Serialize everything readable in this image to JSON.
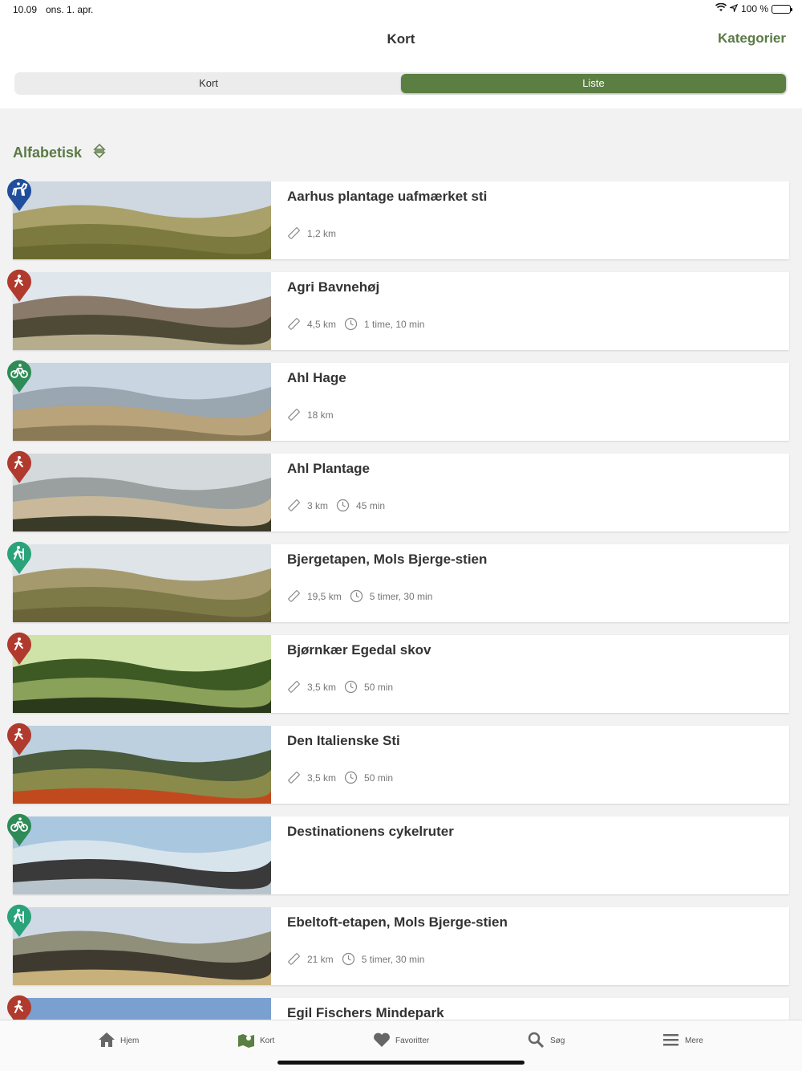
{
  "status": {
    "time": "10.09",
    "date": "ons. 1. apr.",
    "battery": "100 %"
  },
  "nav": {
    "title": "Kort",
    "action": "Kategorier"
  },
  "segments": [
    "Kort",
    "Liste"
  ],
  "sort": {
    "label": "Alfabetisk"
  },
  "routes": [
    {
      "name": "Aarhus plantage uafmærket sti",
      "distance": "1,2 km",
      "duration": "",
      "category": "horse",
      "color": "#1f4e9c"
    },
    {
      "name": "Agri Bavnehøj",
      "distance": "4,5 km",
      "duration": "1 time, 10 min",
      "category": "hike",
      "color": "#b03a2e"
    },
    {
      "name": "Ahl Hage",
      "distance": "18 km",
      "duration": "",
      "category": "bike",
      "color": "#2e8b57"
    },
    {
      "name": "Ahl Plantage",
      "distance": "3 km",
      "duration": "45 min",
      "category": "hike",
      "color": "#b03a2e"
    },
    {
      "name": "Bjergetapen, Mols Bjerge-stien",
      "distance": "19,5 km",
      "duration": "5 timer, 30 min",
      "category": "trail",
      "color": "#2aa37a"
    },
    {
      "name": "Bjørnkær Egedal skov",
      "distance": "3,5 km",
      "duration": "50 min",
      "category": "hike",
      "color": "#b03a2e"
    },
    {
      "name": "Den Italienske Sti",
      "distance": "3,5 km",
      "duration": "50 min",
      "category": "hike",
      "color": "#b03a2e"
    },
    {
      "name": "Destinationens cykelruter",
      "distance": "",
      "duration": "",
      "category": "bike",
      "color": "#2e8b57"
    },
    {
      "name": "Ebeltoft-etapen, Mols Bjerge-stien",
      "distance": "21 km",
      "duration": "5 timer, 30 min",
      "category": "trail",
      "color": "#2aa37a"
    },
    {
      "name": "Egil Fischers Mindepark",
      "distance": "",
      "duration": "",
      "category": "hike",
      "color": "#b03a2e"
    }
  ],
  "tabs": [
    {
      "label": "Hjem",
      "icon": "home-icon"
    },
    {
      "label": "Kort",
      "icon": "map-icon"
    },
    {
      "label": "Favoritter",
      "icon": "heart-icon"
    },
    {
      "label": "Søg",
      "icon": "search-icon"
    },
    {
      "label": "Mere",
      "icon": "menu-icon"
    }
  ],
  "accent": "#5b7f43"
}
